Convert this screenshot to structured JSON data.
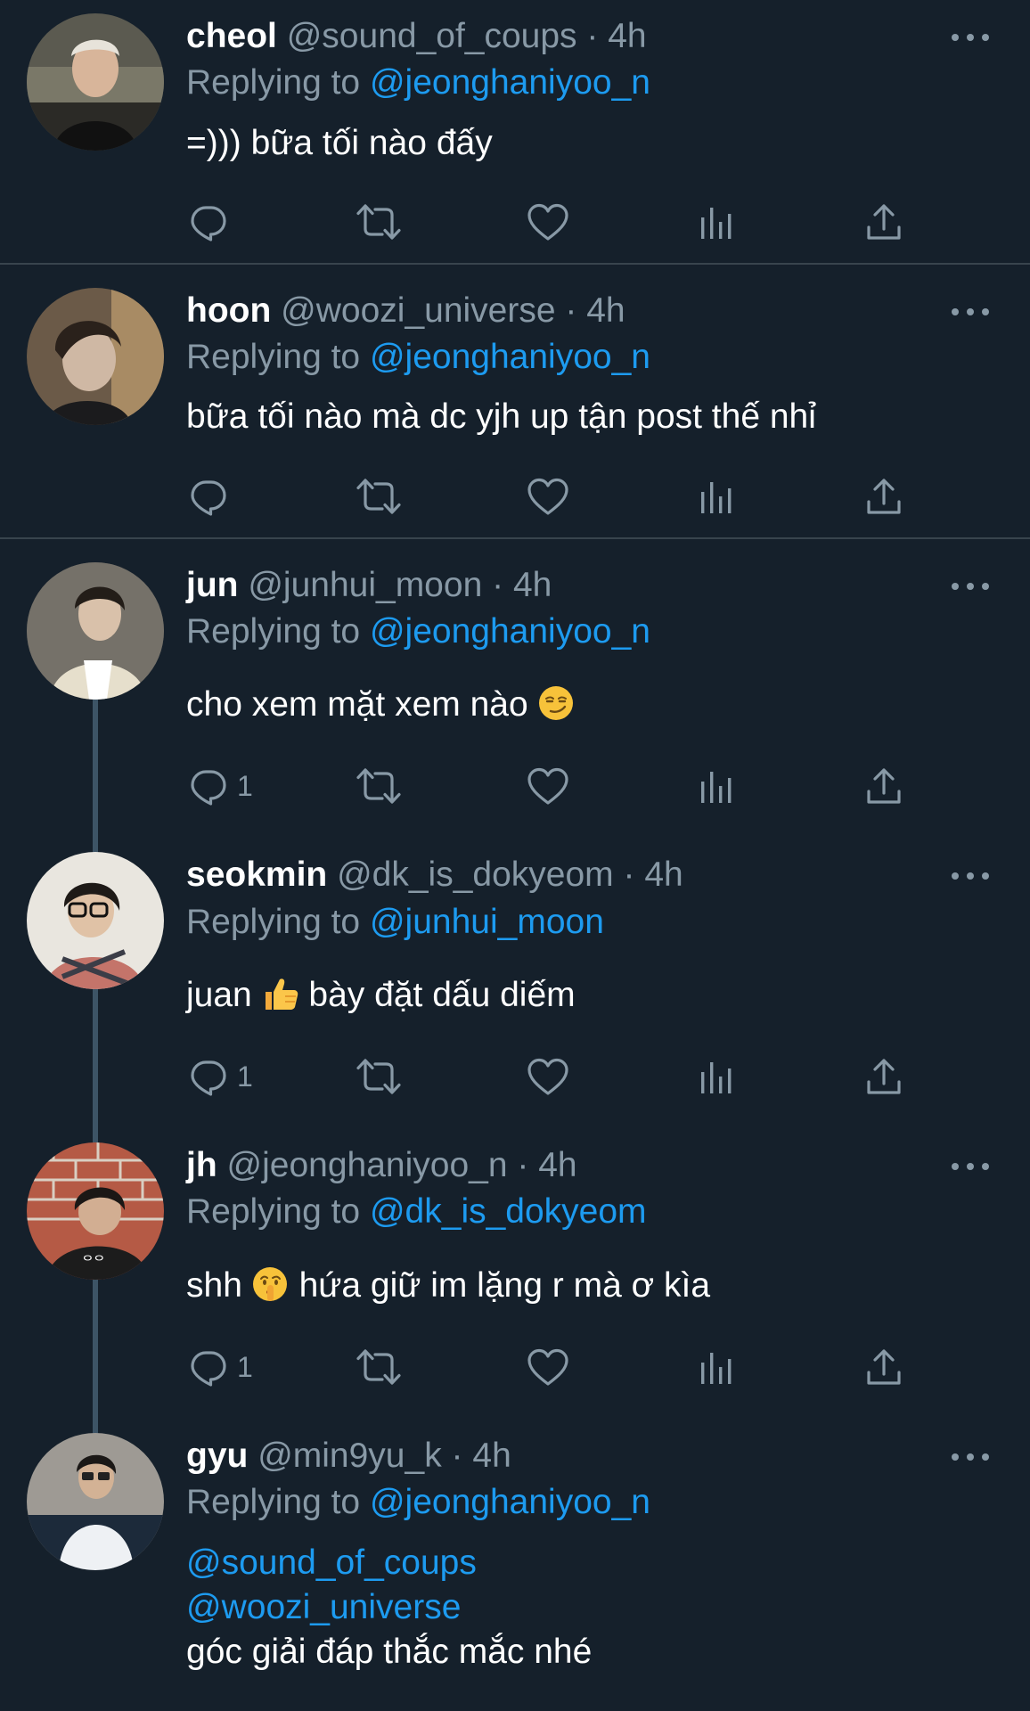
{
  "tweets": [
    {
      "name": "cheol",
      "handle": "@sound_of_coups",
      "dot": "·",
      "time": "4h",
      "replying_prefix": "Replying to",
      "replying_to": "@jeonghaniyoo_n",
      "text": "=))) bữa tối nào đấy",
      "reply_count": ""
    },
    {
      "name": "hoon",
      "handle": "@woozi_universe",
      "dot": "·",
      "time": "4h",
      "replying_prefix": "Replying to",
      "replying_to": "@jeonghaniyoo_n",
      "text": "bữa tối nào mà dc yjh up tận post thế nhỉ",
      "reply_count": ""
    },
    {
      "name": "jun",
      "handle": "@junhui_moon",
      "dot": "·",
      "time": "4h",
      "replying_prefix": "Replying to",
      "replying_to": "@jeonghaniyoo_n",
      "text": "cho xem mặt xem nào",
      "emoji": "smirk",
      "reply_count": "1"
    },
    {
      "name": "seokmin",
      "handle": "@dk_is_dokyeom",
      "dot": "·",
      "time": "4h",
      "replying_prefix": "Replying to",
      "replying_to": "@junhui_moon",
      "text_before": "juan",
      "emoji": "thumbs-up",
      "text_after": "bày đặt dấu diếm",
      "reply_count": "1"
    },
    {
      "name": "jh",
      "handle": "@jeonghaniyoo_n",
      "dot": "·",
      "time": "4h",
      "replying_prefix": "Replying to",
      "replying_to": "@dk_is_dokyeom",
      "text_before": "shh",
      "emoji": "shushing-face",
      "text_after": "hứa giữ im lặng r mà ơ kìa",
      "reply_count": "1"
    },
    {
      "name": "gyu",
      "handle": "@min9yu_k",
      "dot": "·",
      "time": "4h",
      "replying_prefix": "Replying to",
      "replying_to": "@jeonghaniyoo_n",
      "mention_1": "@sound_of_coups",
      "mention_2": "@woozi_universe",
      "text": "góc giải đáp thắc mắc nhé"
    }
  ],
  "icons": [
    "reply-icon",
    "retweet-icon",
    "like-icon",
    "views-icon",
    "share-icon",
    "more-icon"
  ],
  "colors": {
    "background": "#15202b",
    "text": "#ffffff",
    "secondary": "#8899a6",
    "link": "#1d9bf0",
    "divider": "#38444d",
    "thread_line": "#3d5466"
  }
}
